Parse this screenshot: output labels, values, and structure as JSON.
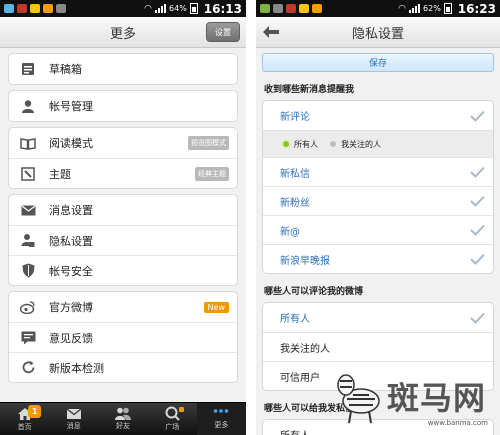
{
  "left": {
    "status": {
      "battery": "64%",
      "time": "16:13"
    },
    "title": "更多",
    "settings_button": "设置",
    "groups": [
      [
        {
          "label": "草稿箱",
          "icon": "draft-icon"
        }
      ],
      [
        {
          "label": "帐号管理",
          "icon": "user-icon"
        }
      ],
      [
        {
          "label": "阅读模式",
          "icon": "book-icon",
          "badge": "预览图模式"
        },
        {
          "label": "主题",
          "icon": "theme-icon",
          "badge": "经典主题"
        }
      ],
      [
        {
          "label": "消息设置",
          "icon": "envelope-icon"
        },
        {
          "label": "隐私设置",
          "icon": "lock-icon"
        },
        {
          "label": "帐号安全",
          "icon": "shield-icon"
        }
      ],
      [
        {
          "label": "官方微博",
          "icon": "weibo-icon",
          "new_badge": "New"
        },
        {
          "label": "意见反馈",
          "icon": "feedback-icon"
        },
        {
          "label": "新版本检测",
          "icon": "refresh-icon"
        }
      ]
    ],
    "tabs": [
      {
        "label": "首页",
        "icon": "home-icon",
        "badge": "1"
      },
      {
        "label": "消息",
        "icon": "message-icon"
      },
      {
        "label": "好友",
        "icon": "friends-icon"
      },
      {
        "label": "广场",
        "icon": "search-icon",
        "dot": true
      },
      {
        "label": "更多",
        "icon": "more-icon",
        "active": true
      }
    ]
  },
  "right": {
    "status": {
      "battery": "62%",
      "time": "16:23"
    },
    "title": "隐私设置",
    "save_label": "保存",
    "section1": {
      "heading": "收到哪些新消息提醒我",
      "first_option": "新评论",
      "sub_options": [
        "所有人",
        "我关注的人"
      ],
      "options": [
        "新私信",
        "新粉丝",
        "新@",
        "新浪早晚报"
      ]
    },
    "section2": {
      "heading": "哪些人可以评论我的微博",
      "options": [
        "所有人",
        "我关注的人",
        "可信用户"
      ]
    },
    "section3": {
      "heading": "哪些人可以给我发私信",
      "options": [
        "所有人"
      ]
    },
    "watermark": {
      "text": "斑马网",
      "url": "www.banma.com"
    }
  },
  "colors": {
    "accent_blue": "#2d6fb8",
    "badge_orange": "#f39800",
    "check_gray": "#a8b8c8"
  }
}
